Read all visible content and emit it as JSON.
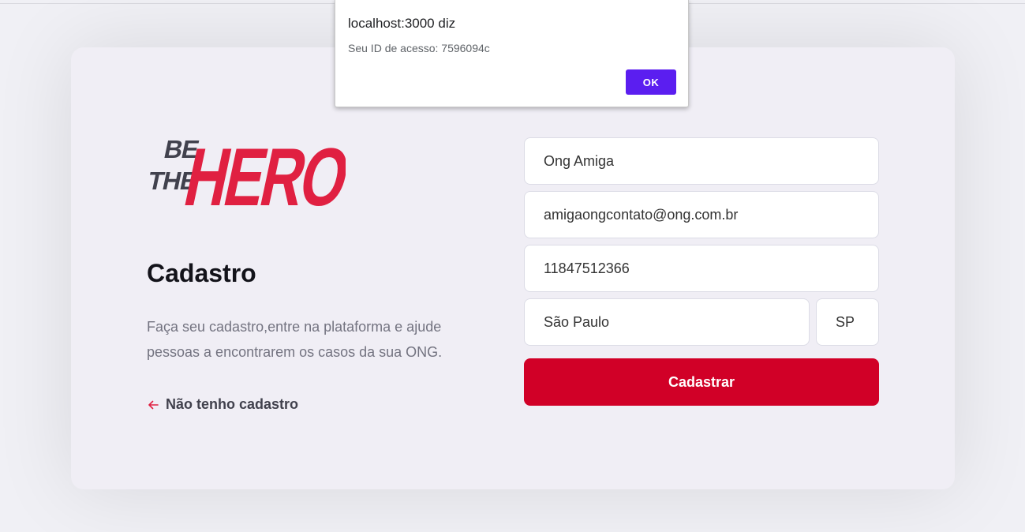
{
  "alert": {
    "title": "localhost:3000 diz",
    "message": "Seu ID de acesso: 7596094c",
    "ok_label": "OK"
  },
  "brand": {
    "logo_word_1": "BE",
    "logo_word_2": "THE",
    "logo_word_3": "HERO",
    "primary_color": "#e02041",
    "dark_color": "#41414d"
  },
  "register": {
    "title": "Cadastro",
    "description": "Faça seu cadastro,entre na plataforma e ajude pessoas a encontrarem os casos da sua ONG.",
    "back_link_label": "Não tenho cadastro",
    "back_icon": "arrow-left-icon"
  },
  "form": {
    "name_value": "Ong Amiga",
    "email_value": "amigaongcontato@ong.com.br",
    "whatsapp_value": "11847512366",
    "city_value": "São Paulo",
    "uf_value": "SP",
    "submit_label": "Cadastrar",
    "submit_color": "#d10027"
  }
}
